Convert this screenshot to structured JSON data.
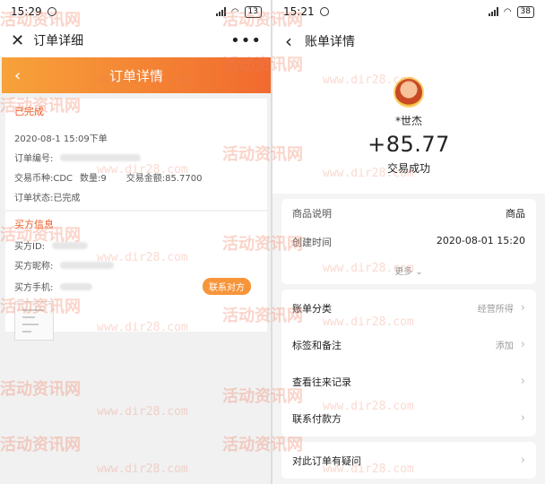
{
  "left": {
    "status_time": "15:29",
    "battery": "13",
    "title": "订单详细",
    "header_title": "订单详情",
    "order_status": "已完成",
    "order_time": "2020-08-1 15:09下单",
    "order_no_label": "订单编号:",
    "coin_label": "交易币种:CDC",
    "qty_label": "数量:9",
    "amount_label": "交易金额:85.7700",
    "state_label": "订单状态:已完成",
    "buyer_section": "买方信息",
    "buyer_id_label": "买方ID:",
    "buyer_nick_label": "买方昵称:",
    "buyer_phone_label": "买方手机:",
    "contact_button": "联系对方"
  },
  "right": {
    "status_time": "15:21",
    "battery": "38",
    "title": "账单详情",
    "name": "*世杰",
    "amount": "+85.77",
    "status": "交易成功",
    "info": [
      {
        "label": "商品说明",
        "value": "商品"
      },
      {
        "label": "创建时间",
        "value": "2020-08-01 15:20"
      }
    ],
    "more": "更多",
    "menu": [
      {
        "label": "账单分类",
        "hint": "经营所得"
      },
      {
        "label": "标签和备注",
        "hint": "添加"
      },
      {
        "label": "查看往来记录",
        "hint": ""
      },
      {
        "label": "联系付款方",
        "hint": ""
      },
      {
        "label": "对此订单有疑问",
        "hint": ""
      }
    ]
  },
  "watermark": {
    "cn": "活动资讯网",
    "url": "www.dir28.com"
  }
}
